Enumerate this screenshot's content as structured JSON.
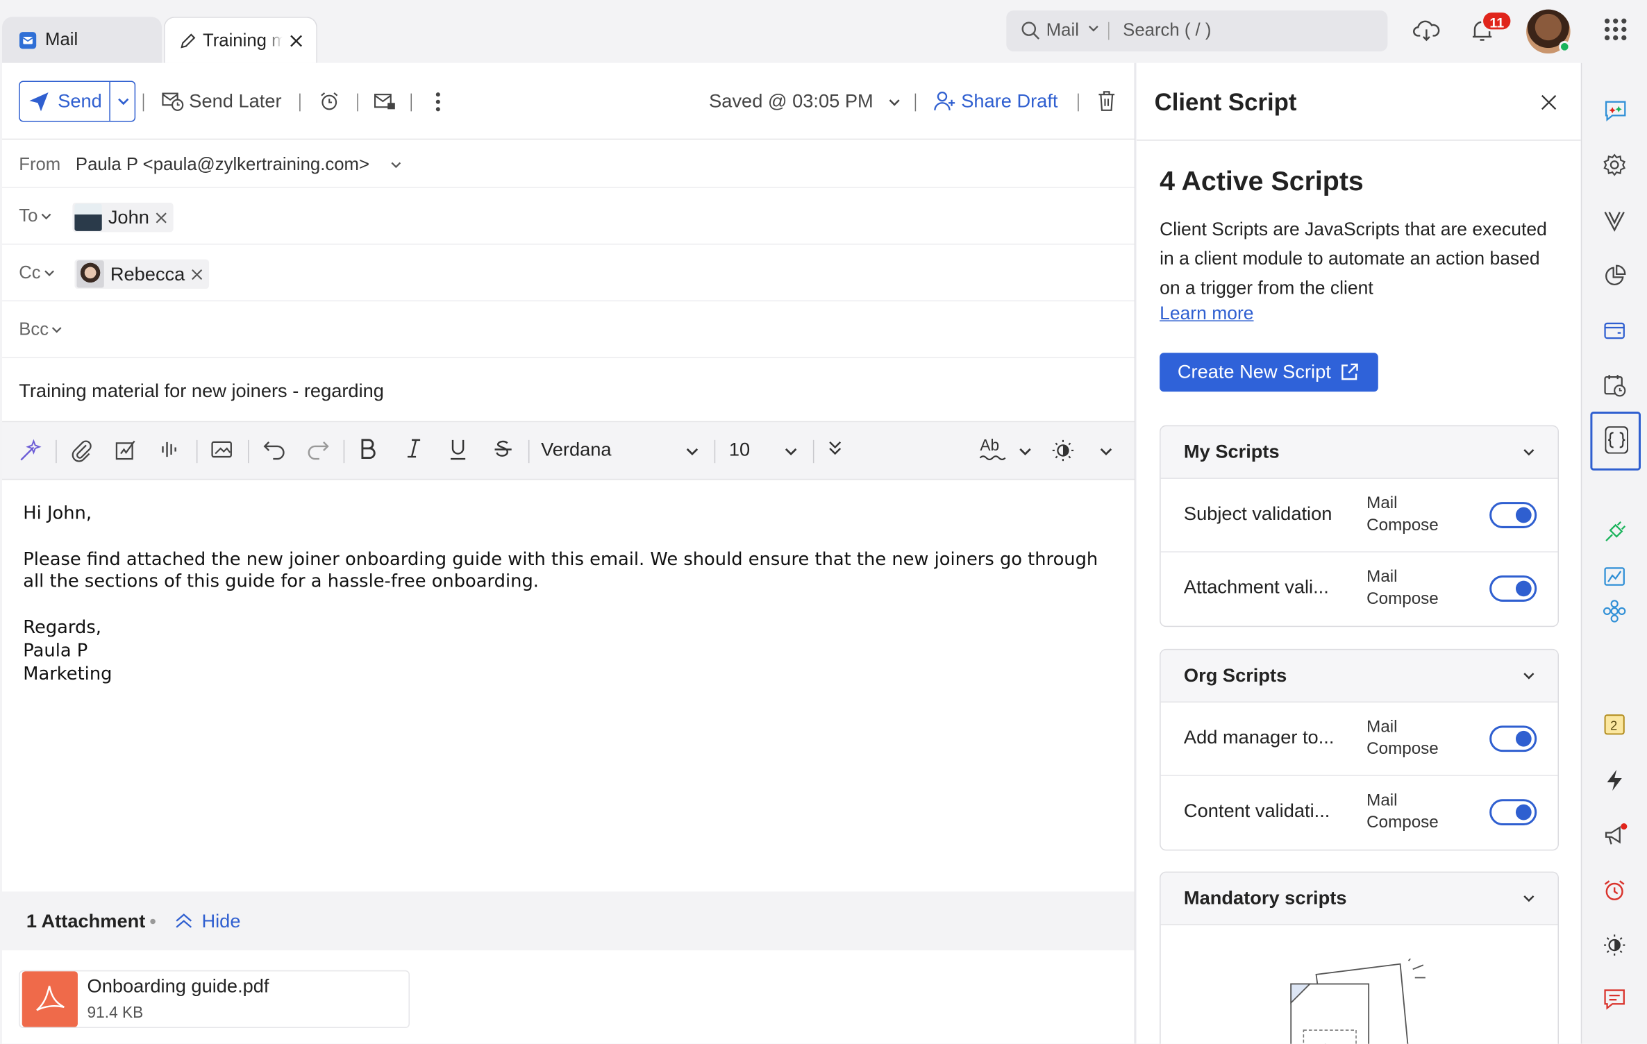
{
  "tabs": [
    {
      "label": "Mail"
    },
    {
      "label": "Training m"
    }
  ],
  "search": {
    "scope": "Mail",
    "placeholder": "Search ( / )"
  },
  "notifications": {
    "count": "11"
  },
  "toolbar": {
    "send_label": "Send",
    "send_later_label": "Send Later",
    "saved_status": "Saved @ 03:05 PM",
    "share_draft_label": "Share Draft"
  },
  "compose": {
    "from_label": "From",
    "from_value": "Paula P <paula@zylkertraining.com>",
    "to_label": "To",
    "to_recipients": [
      "John"
    ],
    "cc_label": "Cc",
    "cc_recipients": [
      "Rebecca"
    ],
    "bcc_label": "Bcc",
    "subject": "Training material for new joiners - regarding",
    "font_family": "Verdana",
    "font_size": "10",
    "body": "Hi John,\n\nPlease find attached the new joiner onboarding guide with this email. We should ensure that the new joiners go through all the sections of this guide for a hassle-free onboarding.\n\nRegards,\nPaula P\nMarketing"
  },
  "attachments": {
    "summary": "1 Attachment",
    "hide_label": "Hide",
    "items": [
      {
        "name": "Onboarding guide.pdf",
        "size": "91.4 KB"
      }
    ]
  },
  "client_script": {
    "title": "Client Script",
    "active_heading": "4 Active Scripts",
    "description": "Client Scripts are JavaScripts that are executed in a client module to automate an action based on a trigger from the client",
    "learn_more": "Learn more",
    "create_button": "Create New Script",
    "sections": [
      {
        "title": "My Scripts",
        "scripts": [
          {
            "name": "Subject validation",
            "module_line1": "Mail",
            "module_line2": "Compose",
            "enabled": true
          },
          {
            "name": "Attachment vali...",
            "module_line1": "Mail",
            "module_line2": "Compose",
            "enabled": true
          }
        ]
      },
      {
        "title": "Org Scripts",
        "scripts": [
          {
            "name": "Add manager to...",
            "module_line1": "Mail",
            "module_line2": "Compose",
            "enabled": true
          },
          {
            "name": "Content validati...",
            "module_line1": "Mail",
            "module_line2": "Compose",
            "enabled": true
          }
        ]
      },
      {
        "title": "Mandatory scripts",
        "scripts": []
      }
    ]
  },
  "rail": {
    "notes_badge": "2"
  },
  "colors": {
    "accent": "#2f5fd0",
    "badge": "#e0241b",
    "pdf": "#ef6a4a",
    "online": "#19b35b"
  }
}
